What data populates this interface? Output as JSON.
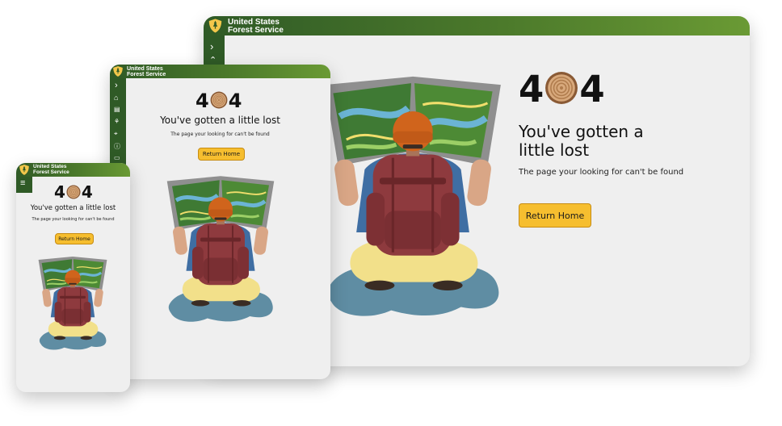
{
  "brand": {
    "line1": "United States",
    "line2": "Forest Service"
  },
  "error": {
    "code_left": "4",
    "code_right": "4",
    "heading_line1": "You've gotten a",
    "heading_line2": "little lost",
    "heading_full": "You've gotten a little lost",
    "message": "The page your looking for can't be found",
    "button_label": "Return Home"
  },
  "colors": {
    "header_dark": "#2f5a26",
    "header_light": "#6a9a34",
    "button": "#f6be2f",
    "background": "#efefef",
    "backpack": "#8e3a3e",
    "hat": "#d0641c",
    "shirt": "#3f6ea3",
    "map_green": "#4d8a35",
    "water": "#5f8da3",
    "pants": "#f2e08a"
  },
  "icons": {
    "sidebar": [
      "chevron-right-icon",
      "chevron-up-icon",
      "home-icon",
      "newspaper-icon",
      "people-icon",
      "location-icon",
      "info-icon",
      "book-icon"
    ],
    "menu": "hamburger-menu-icon"
  }
}
